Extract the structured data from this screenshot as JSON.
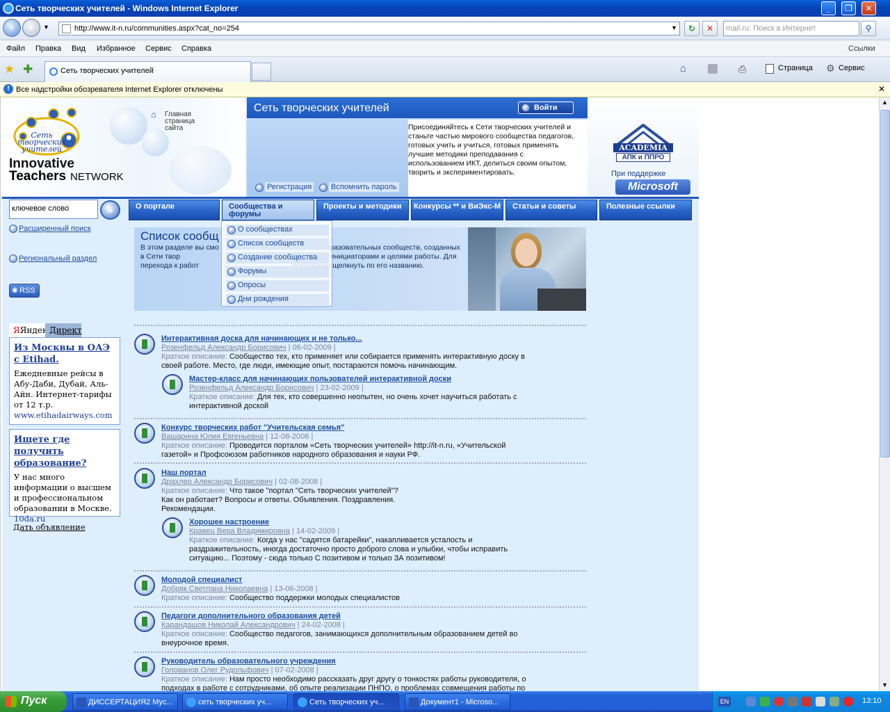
{
  "window": {
    "title": "Сеть творческих учителей - Windows Internet Explorer"
  },
  "browser": {
    "address": "http://www.it-n.ru/communities.aspx?cat_no=254",
    "search_placeholder": "mail.ru: Поиск в Интернет",
    "menu": [
      "Файл",
      "Правка",
      "Вид",
      "Избранное",
      "Сервис",
      "Справка"
    ],
    "links_label": "Ссылки",
    "tab_title": "Сеть творческих учителей",
    "cmd_page": "Страница",
    "cmd_tools": "Сервис",
    "infobar": "Все надстройки обозревателя Internet Explorer отключены"
  },
  "header": {
    "logo_text": "Сеть творческих учителей",
    "home_link": "Главная страница сайта",
    "brand_line1": "Innovative",
    "brand_line2": "Teachers",
    "brand_line3": "NETWORK",
    "site_title": "Сеть творческих учителей",
    "login": "Войти",
    "join_text": "Присоединяйтесь к Сети творческих учителей и станьте частью мирового сообщества педагогов, готовых учить и учиться, готовых применять лучшие методики преподавания с использованием ИКТ, делиться своим опытом, творить и экспериментировать.",
    "register": "Регистрация",
    "remind": "Вспомнить пароль",
    "academia": "ACADEMIA",
    "academia_sub": "АПК и ППРО",
    "support": "При поддержке",
    "microsoft": "Microsoft"
  },
  "search": {
    "keyword": "ключевое слово",
    "advanced": "Расширенный поиск",
    "regional": "Региональный раздел",
    "rss": "RSS"
  },
  "nav": [
    {
      "label": "О портале"
    },
    {
      "label": "Сообщества и форумы"
    },
    {
      "label": "Проекты и методики"
    },
    {
      "label": "Конкурсы ** и ВиЭкс-М"
    },
    {
      "label": "Статьи и советы"
    },
    {
      "label": "Полезные ссылки"
    }
  ],
  "dropdown": [
    "О сообществах",
    "Список сообществ",
    "Создание сообщества",
    "Форумы",
    "Опросы",
    "Дни рождения"
  ],
  "banner": {
    "title": "Список сообщ",
    "text": "В этом разделе вы смо                                              ех образовательных сообществ, созданных в Сети твор                                              накомиться с их инициаторами и целями работы. Для перехода к работ                                              достаточно щелкнуть по его названию."
  },
  "ads": {
    "tab1": "Яндекс",
    "tab2": "Директ",
    "items": [
      {
        "title": "Из Москвы в ОАЭ с Etihad.",
        "text": "Ежедневные рейсы в Абу-Даби, Дубай, Аль-Айн. Интернет-тарифы от 12 т.р.",
        "url": "www.etihadairways.com"
      },
      {
        "title": "Ищете где получить образование?",
        "text": "У нас много информации о высшем и профессиональном образовании в Москве.",
        "url": "10da.ru"
      }
    ],
    "give": "Дать объявление"
  },
  "desc_label": "Краткое описание:",
  "entries": [
    {
      "title": "Интерактивная доска для начинающих и не только...",
      "author": "Розенфельд Александр Борисович",
      "date": "06-02-2009",
      "desc": "Сообщество тех, кто применяет или собирается применять интерактивную доску в своей работе. Место, где люди, имеющие опыт, постараются помочь начинающим."
    },
    {
      "title": "Мастер-класс для начинающих пользователей интерактивной доски",
      "author": "Розенфельд Александр Борисович",
      "date": "23-02-2009",
      "desc": "Для тех, кто совершенно неопытен, но очень хочет научиться работать с интерактивной доской"
    },
    {
      "title": "Конкурс творческих работ \"Учительская семья\"",
      "author": "Вашарина Юлия Евгеньевна",
      "date": "12-08-2008",
      "desc": "Проводится порталом «Сеть творческих учителей» http://it-n.ru, «Учительской газетой» и Профсоюзом работников народного образования и науки РФ."
    },
    {
      "title": "Наш портал",
      "author": "Драхлер Александр Борисович",
      "date": "02-08-2008",
      "desc": "Что такое \"портал \"Сеть творческих учителей\"? Как он работает? Вопросы и ответы. Объявления. Поздравления. Рекомендации."
    },
    {
      "title": "Хорошее настроение",
      "author": "Кравец Вера Владимировна",
      "date": "14-02-2009",
      "desc": "Когда у нас \"садятся батарейки\", накапливается усталость и раздражительность, иногда достаточно просто доброго слова и улыбки, чтобы исправить ситуацию... Поэтому - сюда только С позитивом и только ЗА позитивом!"
    },
    {
      "title": "Молодой специалист",
      "author": "Добряк Светлана Николаевна",
      "date": "13-06-2008",
      "desc": "Сообщество поддержки молодых специалистов"
    },
    {
      "title": "Педагоги дополнительного образования детей",
      "author": "Карандашов Николай Александрович",
      "date": "24-02-2008",
      "desc": "Сообщество педагогов, занимающихся дополнительным образованием детей во внеурочное время."
    },
    {
      "title": "Руководитель образовательного учреждения",
      "author": "Голованов Олег Рудольфович",
      "date": "07-02-2008",
      "desc": "Нам просто необходимо рассказать друг другу о тонкостях работы руководителя, о подходах в работе с сотрудниками, об опыте реализации ПНПО, о проблемах совмещения работы по"
    }
  ],
  "taskbar": {
    "start": "Пуск",
    "tasks": [
      "ДИССЕРТАЦИЯ2 Мус...",
      "сеть творческих уч...",
      "Сеть творческих уч...",
      "Документ1 - Microso..."
    ],
    "lang": "EN",
    "clock": "13:10"
  }
}
